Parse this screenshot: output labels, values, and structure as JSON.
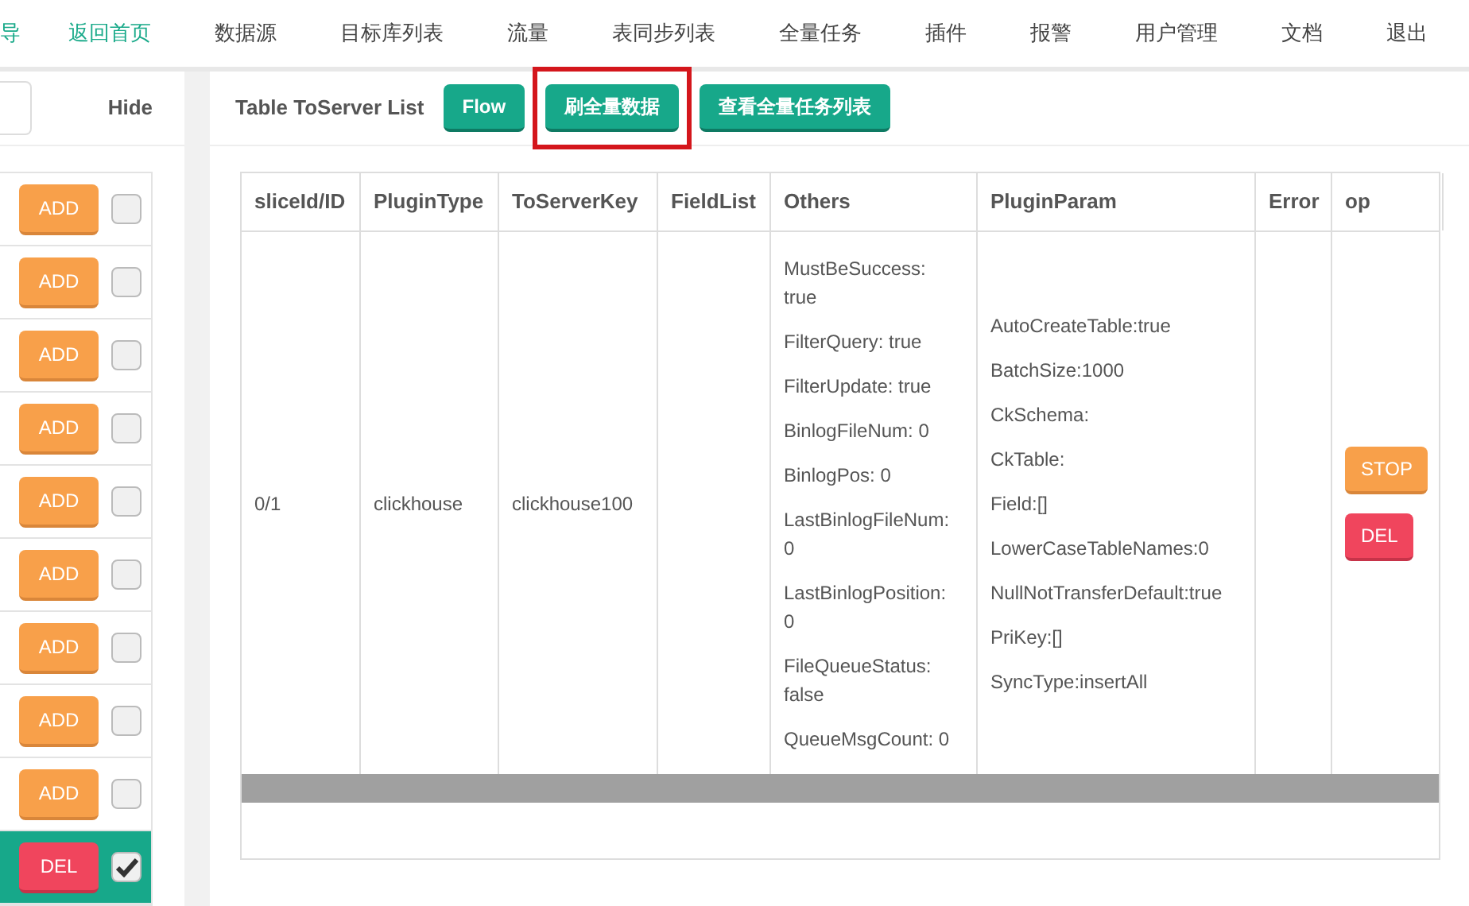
{
  "nav": [
    {
      "label": "导",
      "selected": true
    },
    {
      "label": "返回首页",
      "selected": true
    },
    {
      "label": "数据源",
      "selected": false
    },
    {
      "label": "目标库列表",
      "selected": false
    },
    {
      "label": "流量",
      "selected": false
    },
    {
      "label": "表同步列表",
      "selected": false
    },
    {
      "label": "全量任务",
      "selected": false
    },
    {
      "label": "插件",
      "selected": false
    },
    {
      "label": "报警",
      "selected": false
    },
    {
      "label": "用户管理",
      "selected": false
    },
    {
      "label": "文档",
      "selected": false
    },
    {
      "label": "退出",
      "selected": false
    }
  ],
  "sidebar": {
    "hide": "Hide",
    "rows": [
      {
        "kind": "add",
        "action": "ADD",
        "checked": false,
        "selected": false
      },
      {
        "kind": "add",
        "action": "ADD",
        "checked": false,
        "selected": false
      },
      {
        "kind": "add",
        "action": "ADD",
        "checked": false,
        "selected": false
      },
      {
        "kind": "add",
        "action": "ADD",
        "checked": false,
        "selected": false
      },
      {
        "kind": "add",
        "action": "ADD",
        "checked": false,
        "selected": false
      },
      {
        "kind": "add",
        "action": "ADD",
        "checked": false,
        "selected": false
      },
      {
        "kind": "add",
        "action": "ADD",
        "checked": false,
        "selected": false
      },
      {
        "kind": "add",
        "action": "ADD",
        "checked": false,
        "selected": false
      },
      {
        "kind": "add",
        "action": "ADD",
        "checked": false,
        "selected": false
      },
      {
        "kind": "del",
        "action": "DEL",
        "checked": true,
        "selected": true
      }
    ]
  },
  "main": {
    "title": "Table ToServer List",
    "buttons": [
      {
        "label": "Flow",
        "highlighted": false
      },
      {
        "label": "刷全量数据",
        "highlighted": true
      },
      {
        "label": "查看全量任务列表",
        "highlighted": false
      }
    ]
  },
  "table": {
    "columns": [
      "sliceId/ID",
      "PluginType",
      "ToServerKey",
      "FieldList",
      "Others",
      "PluginParam",
      "Error",
      "op"
    ],
    "rows": [
      {
        "slice_id": "0/1",
        "plugin_type": "clickhouse",
        "to_server_key": "clickhouse100",
        "others": [
          "MustBeSuccess: true",
          "FilterQuery: true",
          "FilterUpdate: true",
          "BinlogFileNum: 0",
          "BinlogPos: 0",
          "LastBinlogFileNum: 0",
          "LastBinlogPosition: 0",
          "FileQueueStatus: false",
          "QueueMsgCount: 0"
        ],
        "plugin_param": [
          "AutoCreateTable:true",
          "BatchSize:1000",
          "CkSchema:",
          "CkTable:",
          "Field:[]",
          "LowerCaseTableNames:0",
          "NullNotTransferDefault:true",
          "PriKey:[]",
          "SyncType:insertAll"
        ],
        "actions": [
          {
            "kind": "stop",
            "label": "STOP"
          },
          {
            "kind": "del",
            "label": "DEL"
          }
        ]
      }
    ]
  }
}
